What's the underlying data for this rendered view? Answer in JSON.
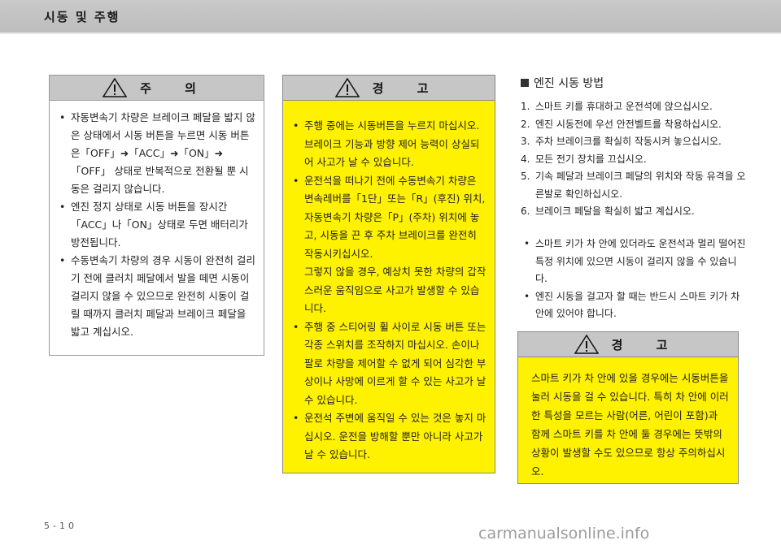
{
  "header": {
    "title": "시동 및 주행"
  },
  "footer": {
    "page_number": "5-10",
    "watermark": "carmanualsonline.info"
  },
  "caution_box": {
    "title": "주 의",
    "items": [
      "자동변속기 차량은 브레이크 페달을 밟지 않은 상태에서 시동 버튼을 누르면 시동 버튼은「OFF」➜「ACC」➜「ON」➜「OFF」 상태로 반복적으로 전환될 뿐 시동은 걸리지 않습니다.",
      "엔진 정지 상태로 시동 버튼을 장시간「ACC」나「ON」상태로 두면 배터리가 방전됩니다.",
      "수동변속기 차량의 경우 시동이 완전히 걸리기 전에 클러치 페달에서 발을 떼면 시동이 걸리지 않을 수 있으므로 완전히 시동이 걸릴 때까지 클러치 페달과 브레이크 페달을 밟고 계십시오."
    ]
  },
  "warning_box_1": {
    "title": "경 고",
    "items": [
      {
        "text": "주행 중에는 시동버튼을 누르지 마십시오. 브레이크 기능과 방향 제어 능력이 상실되어 사고가 날 수 있습니다."
      },
      {
        "text": "운전석을 떠나기 전에 수동변속기 차량은 변속레버를「1단」또는「R」(후진) 위치, 자동변속기 차량은「P」(주차) 위치에 놓고, 시동을 끈 후 주차 브레이크를 완전히 작동시키십시오.",
        "sub": "그렇지 않을 경우, 예상치 못한 차량의 갑작스러운 움직임으로 사고가 발생할 수 있습니다."
      },
      {
        "text": "주행 중 스티어링 휠 사이로 시동 버튼 또는 각종 스위치를 조작하지 마십시오. 손이나 팔로 차량을 제어할 수 없게 되어 심각한 부상이나 사망에 이르게 할 수 있는 사고가 날 수 있습니다."
      },
      {
        "text": "운전석 주변에 움직일 수 있는 것은 놓지 마십시오. 운전을 방해할 뿐만 아니라 사고가 날 수 있습니다."
      }
    ]
  },
  "engine_start": {
    "section_title": "엔진 시동 방법",
    "steps": [
      {
        "num": "1.",
        "text": "스마트 키를 휴대하고 운전석에 앉으십시오."
      },
      {
        "num": "2.",
        "text": "엔진 시동전에 우선 안전벨트를 착용하십시오."
      },
      {
        "num": "3.",
        "text": "주차 브레이크를 확실히 작동시켜 놓으십시오."
      },
      {
        "num": "4.",
        "text": "모든 전기 장치를 끄십시오."
      },
      {
        "num": "5.",
        "text": "기속 페달과 브레이크 페달의 위치와 작동 유격을 오른발로 확인하십시오."
      },
      {
        "num": "6.",
        "text": "브레이크 페달을 확실히 밟고 계십시오."
      }
    ],
    "notes": [
      "스마트 키가 차 안에 있더라도 운전석과 멀리 떨어진 특정 위치에 있으면 시동이 걸리지 않을 수 있습니다.",
      "엔진 시동을 걸고자 할 때는 반드시 스마트 키가 차 안에 있어야 합니다."
    ]
  },
  "warning_box_2": {
    "title": "경 고",
    "text": "스마트 키가 차 안에 있을 경우에는 시동버튼을 눌러 시동을 걸 수 있습니다. 특히 차 안에 이러한 특성을 모르는 사람(어른, 어린이 포함)과 함께 스마트 키를 차 안에 둘 경우에는 뜻밖의 상황이 발생할 수도 있으므로 항상 주의하십시오."
  }
}
